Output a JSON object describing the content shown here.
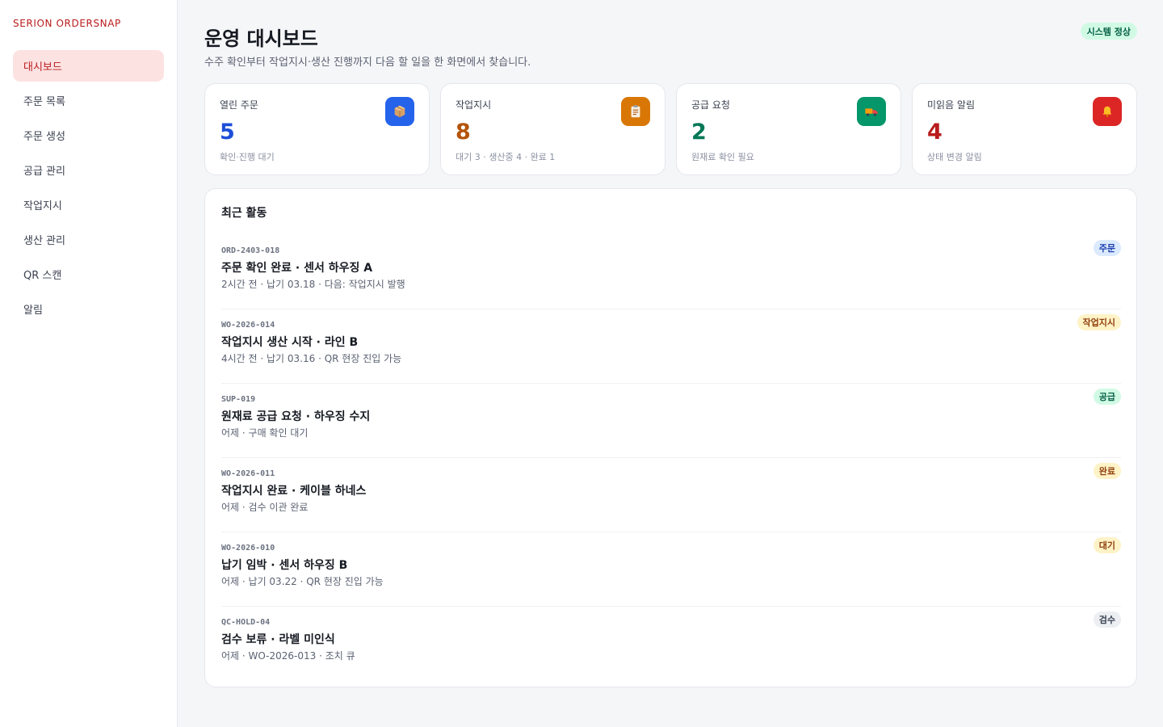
{
  "sidebar": {
    "brand": "SERION ORDERSNAP",
    "items": [
      {
        "label": "대시보드",
        "active": true
      },
      {
        "label": "주문 목록"
      },
      {
        "label": "주문 생성"
      },
      {
        "label": "공급 관리"
      },
      {
        "label": "작업지시"
      },
      {
        "label": "생산 관리"
      },
      {
        "label": "QR 스캔"
      },
      {
        "label": "알림"
      }
    ]
  },
  "header": {
    "title": "운영 대시보드",
    "subtitle": "수주 확인부터 작업지시·생산 진행까지 다음 할 일을 한 화면에서 찾습니다.",
    "status_badge": "시스템 정상"
  },
  "cards": [
    {
      "label": "열린 주문",
      "value": "5",
      "hint": "확인·진행 대기",
      "icon": "package-icon",
      "color": "#2563eb",
      "value_color": "#1d4ed8"
    },
    {
      "label": "작업지시",
      "value": "8",
      "hint": "대기 3 · 생산중 4 · 완료 1",
      "icon": "clipboard-icon",
      "color": "#d97706",
      "value_color": "#b45309"
    },
    {
      "label": "공급 요청",
      "value": "2",
      "hint": "원재료 확인 필요",
      "icon": "truck-icon",
      "color": "#059669",
      "value_color": "#047857"
    },
    {
      "label": "미읽음 알림",
      "value": "4",
      "hint": "상태 변경 알림",
      "icon": "bell-icon",
      "color": "#dc2626",
      "value_color": "#b91c1c"
    }
  ],
  "activity": {
    "title": "최근 활동",
    "items": [
      {
        "code": "ORD-2403-018",
        "title": "주문 확인 완료 · 센서 하우징 A",
        "meta": "2시간 전 · 납기 03.18 · 다음: 작업지시 발행",
        "tag": "주문",
        "tag_bg": "#dbeafe",
        "tag_fg": "#1e40af"
      },
      {
        "code": "WO-2026-014",
        "title": "작업지시 생산 시작 · 라인 B",
        "meta": "4시간 전 · 납기 03.16 · QR 현장 진입 가능",
        "tag": "작업지시",
        "tag_bg": "#fef3c7",
        "tag_fg": "#92400e"
      },
      {
        "code": "SUP-019",
        "title": "원재료 공급 요청 · 하우징 수지",
        "meta": "어제 · 구매 확인 대기",
        "tag": "공급",
        "tag_bg": "#d1fae5",
        "tag_fg": "#065f46"
      },
      {
        "code": "WO-2026-011",
        "title": "작업지시 완료 · 케이블 하네스",
        "meta": "어제 · 검수 이관 완료",
        "tag": "완료",
        "tag_bg": "#fef3c7",
        "tag_fg": "#92400e"
      },
      {
        "code": "WO-2026-010",
        "title": "납기 임박 · 센서 하우징 B",
        "meta": "어제 · 납기 03.22 · QR 현장 진입 가능",
        "tag": "대기",
        "tag_bg": "#fef3c7",
        "tag_fg": "#92400e"
      },
      {
        "code": "QC-HOLD-04",
        "title": "검수 보류 · 라벨 미인식",
        "meta": "어제 · WO-2026-013 · 조치 큐",
        "tag": "검수",
        "tag_bg": "#eceef1",
        "tag_fg": "#374151"
      }
    ]
  }
}
